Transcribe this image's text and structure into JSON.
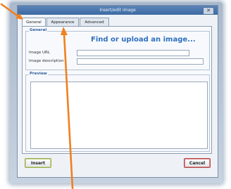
{
  "dialog": {
    "title": "Insert/edit image",
    "close_label": "✕"
  },
  "tabs": [
    {
      "label": "General",
      "active": true
    },
    {
      "label": "Appearance",
      "active": false
    },
    {
      "label": "Advanced",
      "active": false
    }
  ],
  "general": {
    "legend": "General",
    "find_link": "Find or upload an image...",
    "image_url_label": "Image URL",
    "image_url_value": "",
    "image_description_label": "Image description",
    "image_description_value": ""
  },
  "preview": {
    "legend": "Preview"
  },
  "buttons": {
    "insert_label": "Insert",
    "cancel_label": "Cancel"
  },
  "colors": {
    "annotation_arrow": "#f08020",
    "title_bar": "#3c6aa3"
  },
  "icons": {
    "close": "close-icon",
    "annotation": "arrow-annotation"
  }
}
